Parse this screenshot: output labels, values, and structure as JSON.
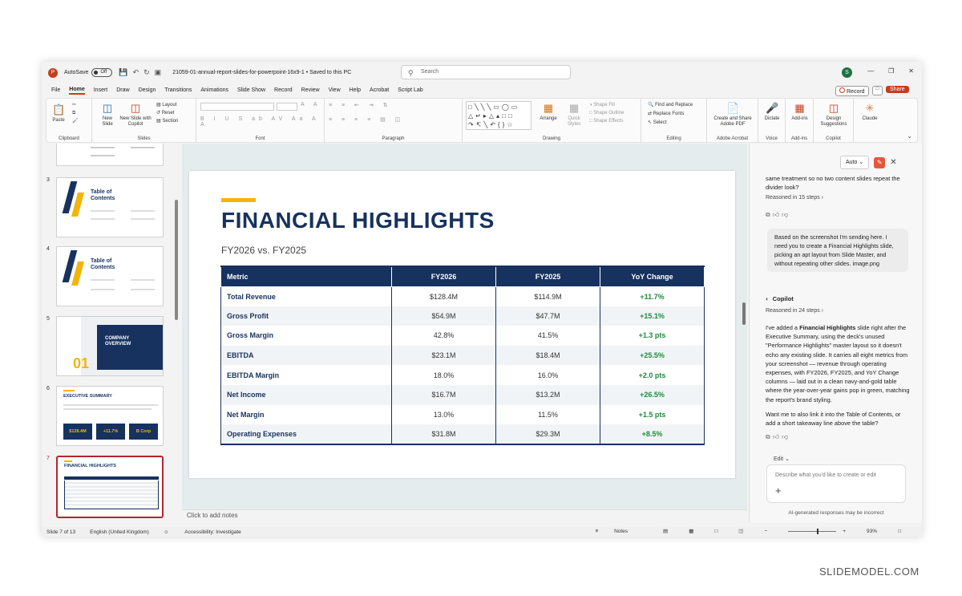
{
  "titlebar": {
    "autosave_label": "AutoSave",
    "autosave_state": "Off",
    "document_title": "21059-01-annual-report-slides-for-powerpoint-16x9-1  •  Saved to this PC",
    "search_placeholder": "Search",
    "user_initial": "S"
  },
  "menu": {
    "tabs": [
      "File",
      "Home",
      "Insert",
      "Draw",
      "Design",
      "Transitions",
      "Animations",
      "Slide Show",
      "Record",
      "Review",
      "View",
      "Help",
      "Acrobat",
      "Script Lab"
    ],
    "active": "Home",
    "record_label": "Record",
    "share_label": "Share"
  },
  "ribbon": {
    "clipboard": {
      "paste": "Paste",
      "group": "Clipboard"
    },
    "slides": {
      "new_slide": "New Slide",
      "new_slide_copilot": "New Slide with Copilot",
      "layout": "Layout",
      "reset": "Reset",
      "section": "Section",
      "group": "Slides"
    },
    "font": {
      "group": "Font"
    },
    "paragraph": {
      "group": "Paragraph"
    },
    "drawing": {
      "arrange": "Arrange",
      "quick_styles": "Quick Styles",
      "shape_fill": "Shape Fill",
      "shape_outline": "Shape Outline",
      "shape_effects": "Shape Effects",
      "group": "Drawing"
    },
    "editing": {
      "find_replace": "Find and Replace",
      "replace_fonts": "Replace Fonts",
      "select": "Select",
      "group": "Editing"
    },
    "acrobat": {
      "create_share": "Create and Share Adobe PDF",
      "group": "Adobe Acrobat"
    },
    "voice": {
      "dictate": "Dictate",
      "group": "Voice"
    },
    "addins": {
      "addins": "Add-ins",
      "group": "Add-ins"
    },
    "copilot": {
      "design_suggestions": "Design Suggestions",
      "group": "Copilot"
    },
    "claude": {
      "label": "Claude"
    }
  },
  "thumbnails": [
    {
      "num": "3",
      "title": "Table of Contents"
    },
    {
      "num": "4",
      "title": "Table of Contents"
    },
    {
      "num": "5",
      "title": "COMPANY OVERVIEW",
      "big": "01"
    },
    {
      "num": "6",
      "title": "EXECUTIVE SUMMARY",
      "tiles": [
        "$128.4M",
        "+11.7%",
        "B Corp"
      ]
    },
    {
      "num": "7",
      "title": "FINANCIAL HIGHLIGHTS"
    }
  ],
  "slide": {
    "title": "FINANCIAL HIGHLIGHTS",
    "subtitle": "FY2026 vs. FY2025",
    "headers": [
      "Metric",
      "FY2026",
      "FY2025",
      "YoY Change"
    ],
    "rows": [
      [
        "Total Revenue",
        "$128.4M",
        "$114.9M",
        "+11.7%"
      ],
      [
        "Gross Profit",
        "$54.9M",
        "$47.7M",
        "+15.1%"
      ],
      [
        "Gross Margin",
        "42.8%",
        "41.5%",
        "+1.3 pts"
      ],
      [
        "EBITDA",
        "$23.1M",
        "$18.4M",
        "+25.5%"
      ],
      [
        "EBITDA Margin",
        "18.0%",
        "16.0%",
        "+2.0 pts"
      ],
      [
        "Net Income",
        "$16.7M",
        "$13.2M",
        "+26.5%"
      ],
      [
        "Net Margin",
        "13.0%",
        "11.5%",
        "+1.5 pts"
      ],
      [
        "Operating Expenses",
        "$31.8M",
        "$29.3M",
        "+8.5%"
      ]
    ]
  },
  "notes_placeholder": "Click to add notes",
  "copilot": {
    "mode": "Auto",
    "prev_text": "same treatment so no two content slides repeat the divider look?",
    "reasoned_1": "Reasoned in 15 steps",
    "user_message": "Based on the screenshot I'm sending here. I need you to create a Financial Highlights slide, picking an apt layout from Slide Master, and without repeating other slides. image.png",
    "name": "Copilot",
    "reasoned_2": "Reasoned in 24 steps",
    "reply_pre": "I've added a ",
    "reply_bold": "Financial Highlights",
    "reply_post": " slide right after the Executive Summary, using the deck's unused \"Performance Highlights\" master layout so it doesn't echo any existing slide. It carries all eight metrics from your screenshot — revenue through operating expenses, with FY2026, FY2025, and YoY Change columns — laid out in a clean navy-and-gold table where the year-over-year gains pop in green, matching the report's brand styling.",
    "followup": "Want me to also link it into the Table of Contents, or add a short takeaway line above the table?",
    "edit_label": "Edit",
    "input_placeholder": "Describe what you'd like to create or edit",
    "disclaimer": "AI-generated responses may be incorrect"
  },
  "status": {
    "slide_count": "Slide 7 of 13",
    "language": "English (United Kingdom)",
    "accessibility": "Accessibility: Investigate",
    "notes": "Notes",
    "zoom": "93%"
  },
  "watermark": "SLIDEMODEL.COM",
  "colors": {
    "navy": "#17325e",
    "gold": "#f3b50c",
    "green": "#1e8a3c",
    "accent": "#c43e1c"
  }
}
